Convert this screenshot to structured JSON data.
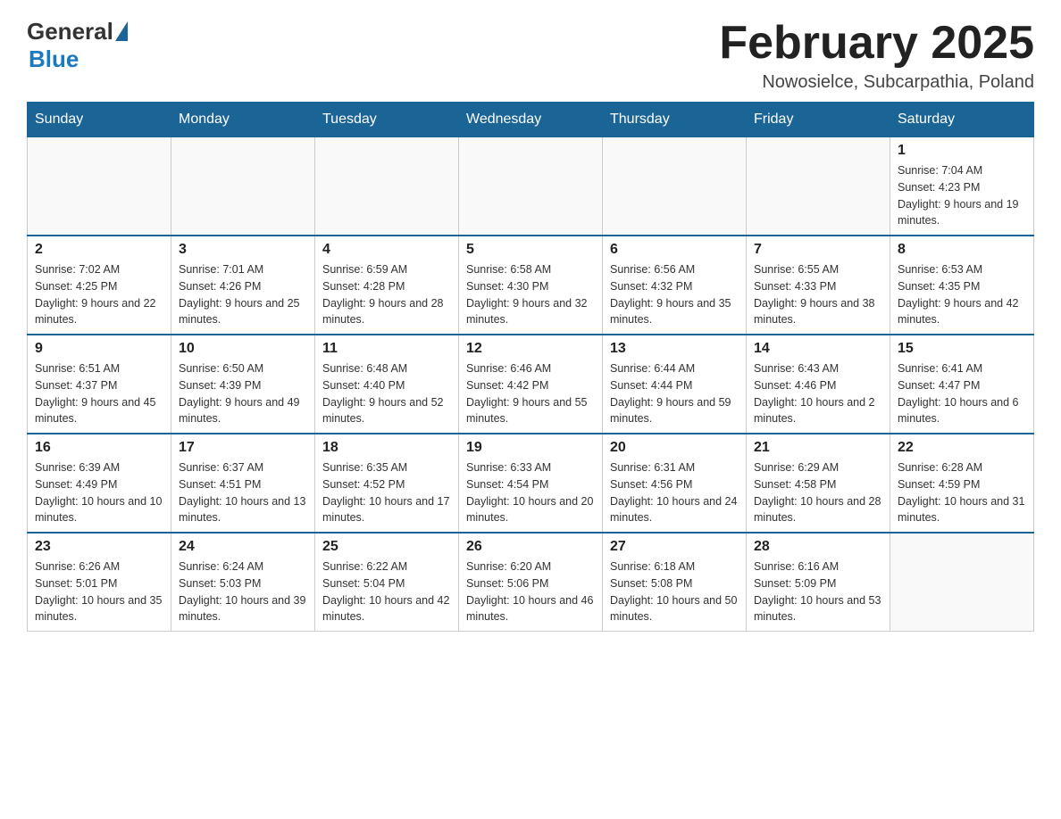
{
  "logo": {
    "general": "General",
    "blue": "Blue"
  },
  "header": {
    "month": "February 2025",
    "location": "Nowosielce, Subcarpathia, Poland"
  },
  "weekdays": [
    "Sunday",
    "Monday",
    "Tuesday",
    "Wednesday",
    "Thursday",
    "Friday",
    "Saturday"
  ],
  "weeks": [
    [
      {
        "day": "",
        "info": ""
      },
      {
        "day": "",
        "info": ""
      },
      {
        "day": "",
        "info": ""
      },
      {
        "day": "",
        "info": ""
      },
      {
        "day": "",
        "info": ""
      },
      {
        "day": "",
        "info": ""
      },
      {
        "day": "1",
        "info": "Sunrise: 7:04 AM\nSunset: 4:23 PM\nDaylight: 9 hours and 19 minutes."
      }
    ],
    [
      {
        "day": "2",
        "info": "Sunrise: 7:02 AM\nSunset: 4:25 PM\nDaylight: 9 hours and 22 minutes."
      },
      {
        "day": "3",
        "info": "Sunrise: 7:01 AM\nSunset: 4:26 PM\nDaylight: 9 hours and 25 minutes."
      },
      {
        "day": "4",
        "info": "Sunrise: 6:59 AM\nSunset: 4:28 PM\nDaylight: 9 hours and 28 minutes."
      },
      {
        "day": "5",
        "info": "Sunrise: 6:58 AM\nSunset: 4:30 PM\nDaylight: 9 hours and 32 minutes."
      },
      {
        "day": "6",
        "info": "Sunrise: 6:56 AM\nSunset: 4:32 PM\nDaylight: 9 hours and 35 minutes."
      },
      {
        "day": "7",
        "info": "Sunrise: 6:55 AM\nSunset: 4:33 PM\nDaylight: 9 hours and 38 minutes."
      },
      {
        "day": "8",
        "info": "Sunrise: 6:53 AM\nSunset: 4:35 PM\nDaylight: 9 hours and 42 minutes."
      }
    ],
    [
      {
        "day": "9",
        "info": "Sunrise: 6:51 AM\nSunset: 4:37 PM\nDaylight: 9 hours and 45 minutes."
      },
      {
        "day": "10",
        "info": "Sunrise: 6:50 AM\nSunset: 4:39 PM\nDaylight: 9 hours and 49 minutes."
      },
      {
        "day": "11",
        "info": "Sunrise: 6:48 AM\nSunset: 4:40 PM\nDaylight: 9 hours and 52 minutes."
      },
      {
        "day": "12",
        "info": "Sunrise: 6:46 AM\nSunset: 4:42 PM\nDaylight: 9 hours and 55 minutes."
      },
      {
        "day": "13",
        "info": "Sunrise: 6:44 AM\nSunset: 4:44 PM\nDaylight: 9 hours and 59 minutes."
      },
      {
        "day": "14",
        "info": "Sunrise: 6:43 AM\nSunset: 4:46 PM\nDaylight: 10 hours and 2 minutes."
      },
      {
        "day": "15",
        "info": "Sunrise: 6:41 AM\nSunset: 4:47 PM\nDaylight: 10 hours and 6 minutes."
      }
    ],
    [
      {
        "day": "16",
        "info": "Sunrise: 6:39 AM\nSunset: 4:49 PM\nDaylight: 10 hours and 10 minutes."
      },
      {
        "day": "17",
        "info": "Sunrise: 6:37 AM\nSunset: 4:51 PM\nDaylight: 10 hours and 13 minutes."
      },
      {
        "day": "18",
        "info": "Sunrise: 6:35 AM\nSunset: 4:52 PM\nDaylight: 10 hours and 17 minutes."
      },
      {
        "day": "19",
        "info": "Sunrise: 6:33 AM\nSunset: 4:54 PM\nDaylight: 10 hours and 20 minutes."
      },
      {
        "day": "20",
        "info": "Sunrise: 6:31 AM\nSunset: 4:56 PM\nDaylight: 10 hours and 24 minutes."
      },
      {
        "day": "21",
        "info": "Sunrise: 6:29 AM\nSunset: 4:58 PM\nDaylight: 10 hours and 28 minutes."
      },
      {
        "day": "22",
        "info": "Sunrise: 6:28 AM\nSunset: 4:59 PM\nDaylight: 10 hours and 31 minutes."
      }
    ],
    [
      {
        "day": "23",
        "info": "Sunrise: 6:26 AM\nSunset: 5:01 PM\nDaylight: 10 hours and 35 minutes."
      },
      {
        "day": "24",
        "info": "Sunrise: 6:24 AM\nSunset: 5:03 PM\nDaylight: 10 hours and 39 minutes."
      },
      {
        "day": "25",
        "info": "Sunrise: 6:22 AM\nSunset: 5:04 PM\nDaylight: 10 hours and 42 minutes."
      },
      {
        "day": "26",
        "info": "Sunrise: 6:20 AM\nSunset: 5:06 PM\nDaylight: 10 hours and 46 minutes."
      },
      {
        "day": "27",
        "info": "Sunrise: 6:18 AM\nSunset: 5:08 PM\nDaylight: 10 hours and 50 minutes."
      },
      {
        "day": "28",
        "info": "Sunrise: 6:16 AM\nSunset: 5:09 PM\nDaylight: 10 hours and 53 minutes."
      },
      {
        "day": "",
        "info": ""
      }
    ]
  ]
}
